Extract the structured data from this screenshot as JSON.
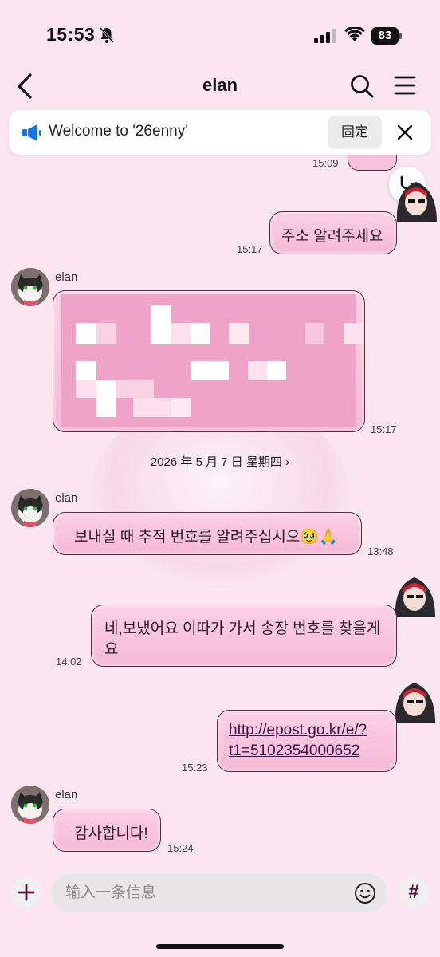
{
  "status_bar": {
    "time": "15:53",
    "battery": "83"
  },
  "header": {
    "title": "elan"
  },
  "notice": {
    "text": "Welcome to '26enny'",
    "pin_label": "固定"
  },
  "messages": [
    {
      "time": "15:09"
    },
    {
      "text": "주소 알려주세요",
      "time": "15:17"
    },
    {
      "sender": "elan",
      "time": "15:17",
      "blurred": true
    },
    {
      "sender": "elan",
      "text": "보내실 때 추적 번호를 알려주십시오🥹🙏",
      "time": "13:48"
    },
    {
      "text_line1": "네,보냈어요 이따가 가서 송장 번호를 찾을게",
      "text_line2": "요",
      "time": "14:02"
    },
    {
      "link_line1": "http://epost.go.kr/e/?",
      "link_line2": "t1=5102354000652",
      "time": "15:23"
    },
    {
      "sender": "elan",
      "text": "감사합니다!",
      "time": "15:24"
    }
  ],
  "date_divider": "2026 年 5 月 7 日 星期四 ›",
  "input": {
    "placeholder": "输入一条信息",
    "hash_label": "#"
  },
  "colors": {
    "bubble": "#f6b9d6",
    "background": "#fbe6f0",
    "border": "#4a3042"
  }
}
